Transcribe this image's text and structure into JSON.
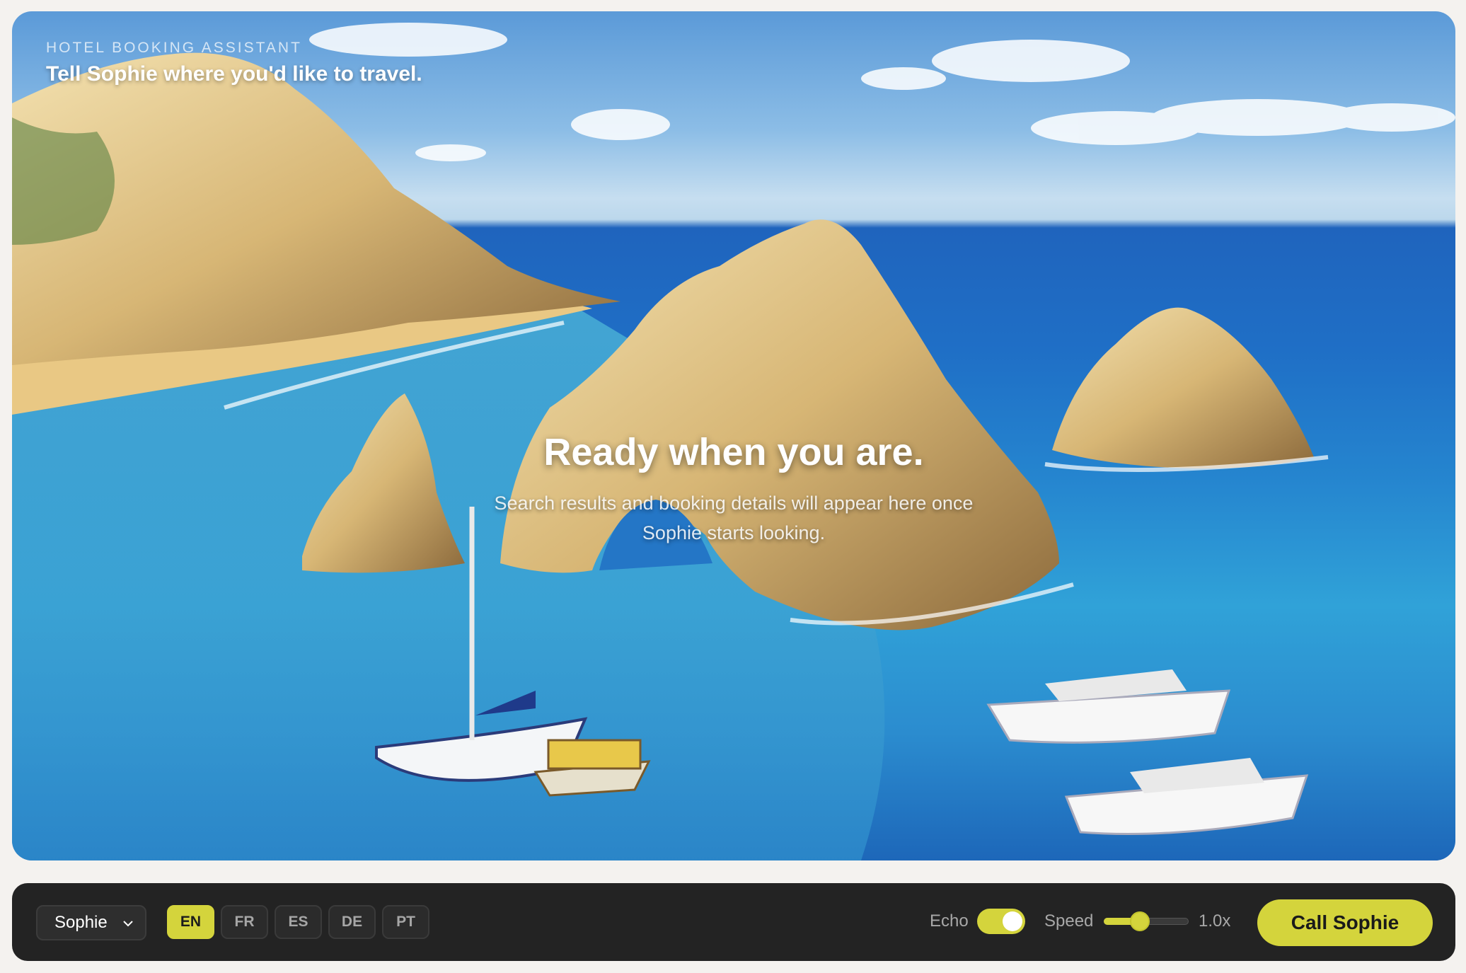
{
  "hero": {
    "eyebrow": "HOTEL BOOKING ASSISTANT",
    "tagline": "Tell Sophie where you'd like to travel.",
    "empty_title": "Ready when you are.",
    "empty_body": "Search results and booking details will appear here once Sophie starts looking."
  },
  "controls": {
    "voice_select": {
      "value": "Sophie",
      "icon": "chevron-down-icon"
    },
    "languages": [
      {
        "code": "EN",
        "active": true
      },
      {
        "code": "FR",
        "active": false
      },
      {
        "code": "ES",
        "active": false
      },
      {
        "code": "DE",
        "active": false
      },
      {
        "code": "PT",
        "active": false
      }
    ],
    "echo": {
      "label": "Echo",
      "enabled": true
    },
    "speed": {
      "label": "Speed",
      "value_text": "1.0x",
      "level": 0.4
    },
    "call_button": "Call Sophie"
  },
  "colors": {
    "accent": "#d4d43c",
    "bar_background": "#232323",
    "page_background": "#f4f2ef"
  }
}
